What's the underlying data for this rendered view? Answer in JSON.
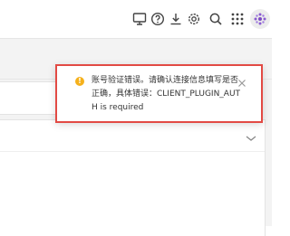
{
  "header": {
    "icons": [
      "monitor-icon",
      "help-icon",
      "download-icon",
      "settings-icon",
      "search-icon",
      "apps-grid-icon"
    ],
    "avatar": "avatar"
  },
  "notification": {
    "type": "warning",
    "message": "账号验证错误。请确认连接信息填写是否正确，具体错误：CLIENT_PLUGIN_AUTH is required",
    "border_color": "#e24a44",
    "icon_color": "#f5b11c",
    "icon_glyph": "!"
  }
}
